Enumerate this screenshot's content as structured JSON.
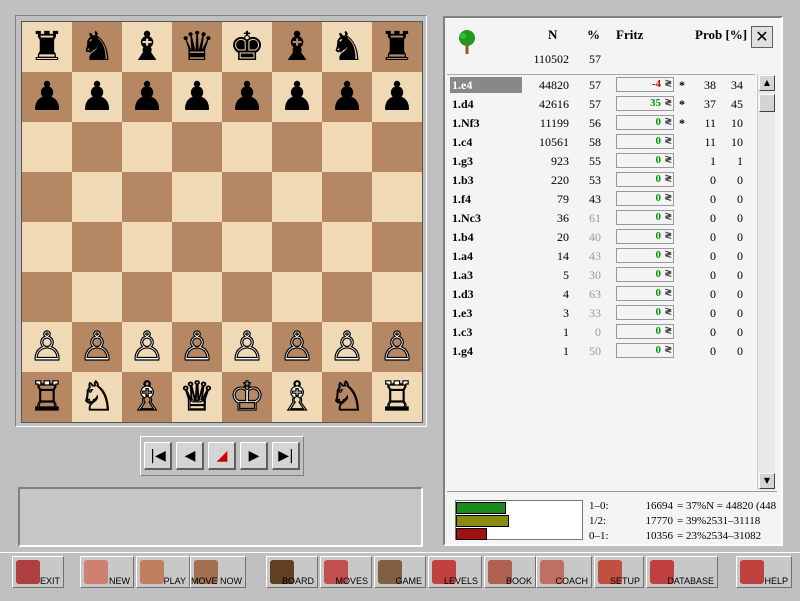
{
  "board": {
    "ranks": [
      [
        "♜",
        "♞",
        "♝",
        "♛",
        "♚",
        "♝",
        "♞",
        "♜"
      ],
      [
        "♟",
        "♟",
        "♟",
        "♟",
        "♟",
        "♟",
        "♟",
        "♟"
      ],
      [
        "",
        "",
        "",
        "",
        "",
        "",
        "",
        ""
      ],
      [
        "",
        "",
        "",
        "",
        "",
        "",
        "",
        ""
      ],
      [
        "",
        "",
        "",
        "",
        "",
        "",
        "",
        ""
      ],
      [
        "",
        "",
        "",
        "",
        "",
        "",
        "",
        ""
      ],
      [
        "♙",
        "♙",
        "♙",
        "♙",
        "♙",
        "♙",
        "♙",
        "♙"
      ],
      [
        "♖",
        "♘",
        "♗",
        "♕",
        "♔",
        "♗",
        "♘",
        "♖"
      ]
    ],
    "light_color": "#f0d9b5",
    "dark_color": "#b58863"
  },
  "nav": {
    "buttons": [
      "first-icon",
      "back-icon",
      "takeback-icon",
      "forward-icon",
      "last-icon"
    ],
    "glyphs": [
      "|◀",
      "◀",
      "◢",
      "▶",
      "▶|"
    ]
  },
  "book": {
    "headers": {
      "n": "N",
      "pct": "%",
      "fritz": "Fritz",
      "prob": "Prob [%]"
    },
    "total_n": "110502",
    "total_pct": "57",
    "close_glyph": "✕",
    "rows": [
      {
        "move": "1.e4",
        "n": "44820",
        "pct": "57",
        "fritz": "-4",
        "fritz_color": "#cc0000",
        "star": "*",
        "prob": "38",
        "p2": "34",
        "selected": true
      },
      {
        "move": "1.d4",
        "n": "42616",
        "pct": "57",
        "fritz": "35",
        "fritz_color": "#009900",
        "star": "*",
        "prob": "37",
        "p2": "45"
      },
      {
        "move": "1.Nf3",
        "n": "11199",
        "pct": "56",
        "fritz": "0",
        "fritz_color": "#009900",
        "star": "*",
        "prob": "11",
        "p2": "10"
      },
      {
        "move": "1.c4",
        "n": "10561",
        "pct": "58",
        "fritz": "0",
        "fritz_color": "#009900",
        "star": "",
        "prob": "11",
        "p2": "10"
      },
      {
        "move": "1.g3",
        "n": "923",
        "pct": "55",
        "fritz": "0",
        "fritz_color": "#009900",
        "star": "",
        "prob": "1",
        "p2": "1"
      },
      {
        "move": "1.b3",
        "n": "220",
        "pct": "53",
        "fritz": "0",
        "fritz_color": "#009900",
        "star": "",
        "prob": "0",
        "p2": "0"
      },
      {
        "move": "1.f4",
        "n": "79",
        "pct": "43",
        "fritz": "0",
        "fritz_color": "#009900",
        "star": "",
        "prob": "0",
        "p2": "0"
      },
      {
        "move": "1.Nc3",
        "n": "36",
        "pct": "61",
        "pct_grey": true,
        "fritz": "0",
        "fritz_color": "#009900",
        "star": "",
        "prob": "0",
        "p2": "0"
      },
      {
        "move": "1.b4",
        "n": "20",
        "pct": "40",
        "pct_grey": true,
        "fritz": "0",
        "fritz_color": "#009900",
        "star": "",
        "prob": "0",
        "p2": "0"
      },
      {
        "move": "1.a4",
        "n": "14",
        "pct": "43",
        "pct_grey": true,
        "fritz": "0",
        "fritz_color": "#009900",
        "star": "",
        "prob": "0",
        "p2": "0"
      },
      {
        "move": "1.a3",
        "n": "5",
        "pct": "30",
        "pct_grey": true,
        "fritz": "0",
        "fritz_color": "#009900",
        "star": "",
        "prob": "0",
        "p2": "0"
      },
      {
        "move": "1.d3",
        "n": "4",
        "pct": "63",
        "pct_grey": true,
        "fritz": "0",
        "fritz_color": "#009900",
        "star": "",
        "prob": "0",
        "p2": "0"
      },
      {
        "move": "1.e3",
        "n": "3",
        "pct": "33",
        "pct_grey": true,
        "fritz": "0",
        "fritz_color": "#009900",
        "star": "",
        "prob": "0",
        "p2": "0"
      },
      {
        "move": "1.c3",
        "n": "1",
        "pct": "0",
        "pct_grey": true,
        "fritz": "0",
        "fritz_color": "#009900",
        "star": "",
        "prob": "0",
        "p2": "0"
      },
      {
        "move": "1.g4",
        "n": "1",
        "pct": "50",
        "pct_grey": true,
        "fritz": "0",
        "fritz_color": "#009900",
        "star": "",
        "prob": "0",
        "p2": "0"
      }
    ]
  },
  "stats": {
    "rows": [
      {
        "label": "1–0:",
        "count": "16694",
        "rest": "= 37%N = 44820 (448",
        "color": "#1a8a1a",
        "fraction": 0.37
      },
      {
        "label": "1/2:",
        "count": "17770",
        "rest": "= 39%2531–31118",
        "color": "#8a8a10",
        "fraction": 0.39
      },
      {
        "label": "0–1:",
        "count": "10356",
        "rest": "= 23%2534–31082",
        "color": "#a01010",
        "fraction": 0.23
      }
    ]
  },
  "toolbar": [
    {
      "label": "EXIT",
      "icon": "exit-icon",
      "color": "#b04040"
    },
    {
      "label": "NEW",
      "icon": "new-icon",
      "color": "#d08070"
    },
    {
      "label": "PLAY",
      "icon": "play-icon",
      "color": "#c08060"
    },
    {
      "label": "MOVE NOW",
      "icon": "move-now-icon",
      "color": "#a07050"
    },
    {
      "label": "BOARD",
      "icon": "board-icon",
      "color": "#604020"
    },
    {
      "label": "MOVES",
      "icon": "moves-icon",
      "color": "#c05050"
    },
    {
      "label": "GAME",
      "icon": "game-icon",
      "color": "#806040"
    },
    {
      "label": "LEVELS",
      "icon": "levels-icon",
      "color": "#c04040"
    },
    {
      "label": "BOOK",
      "icon": "book-icon",
      "color": "#b06050"
    },
    {
      "label": "COACH",
      "icon": "coach-icon",
      "color": "#c07060"
    },
    {
      "label": "SETUP",
      "icon": "setup-icon",
      "color": "#c05040"
    },
    {
      "label": "DATABASE",
      "icon": "database-icon",
      "color": "#c04040"
    },
    {
      "label": "HELP",
      "icon": "help-icon",
      "color": "#c04040"
    }
  ]
}
